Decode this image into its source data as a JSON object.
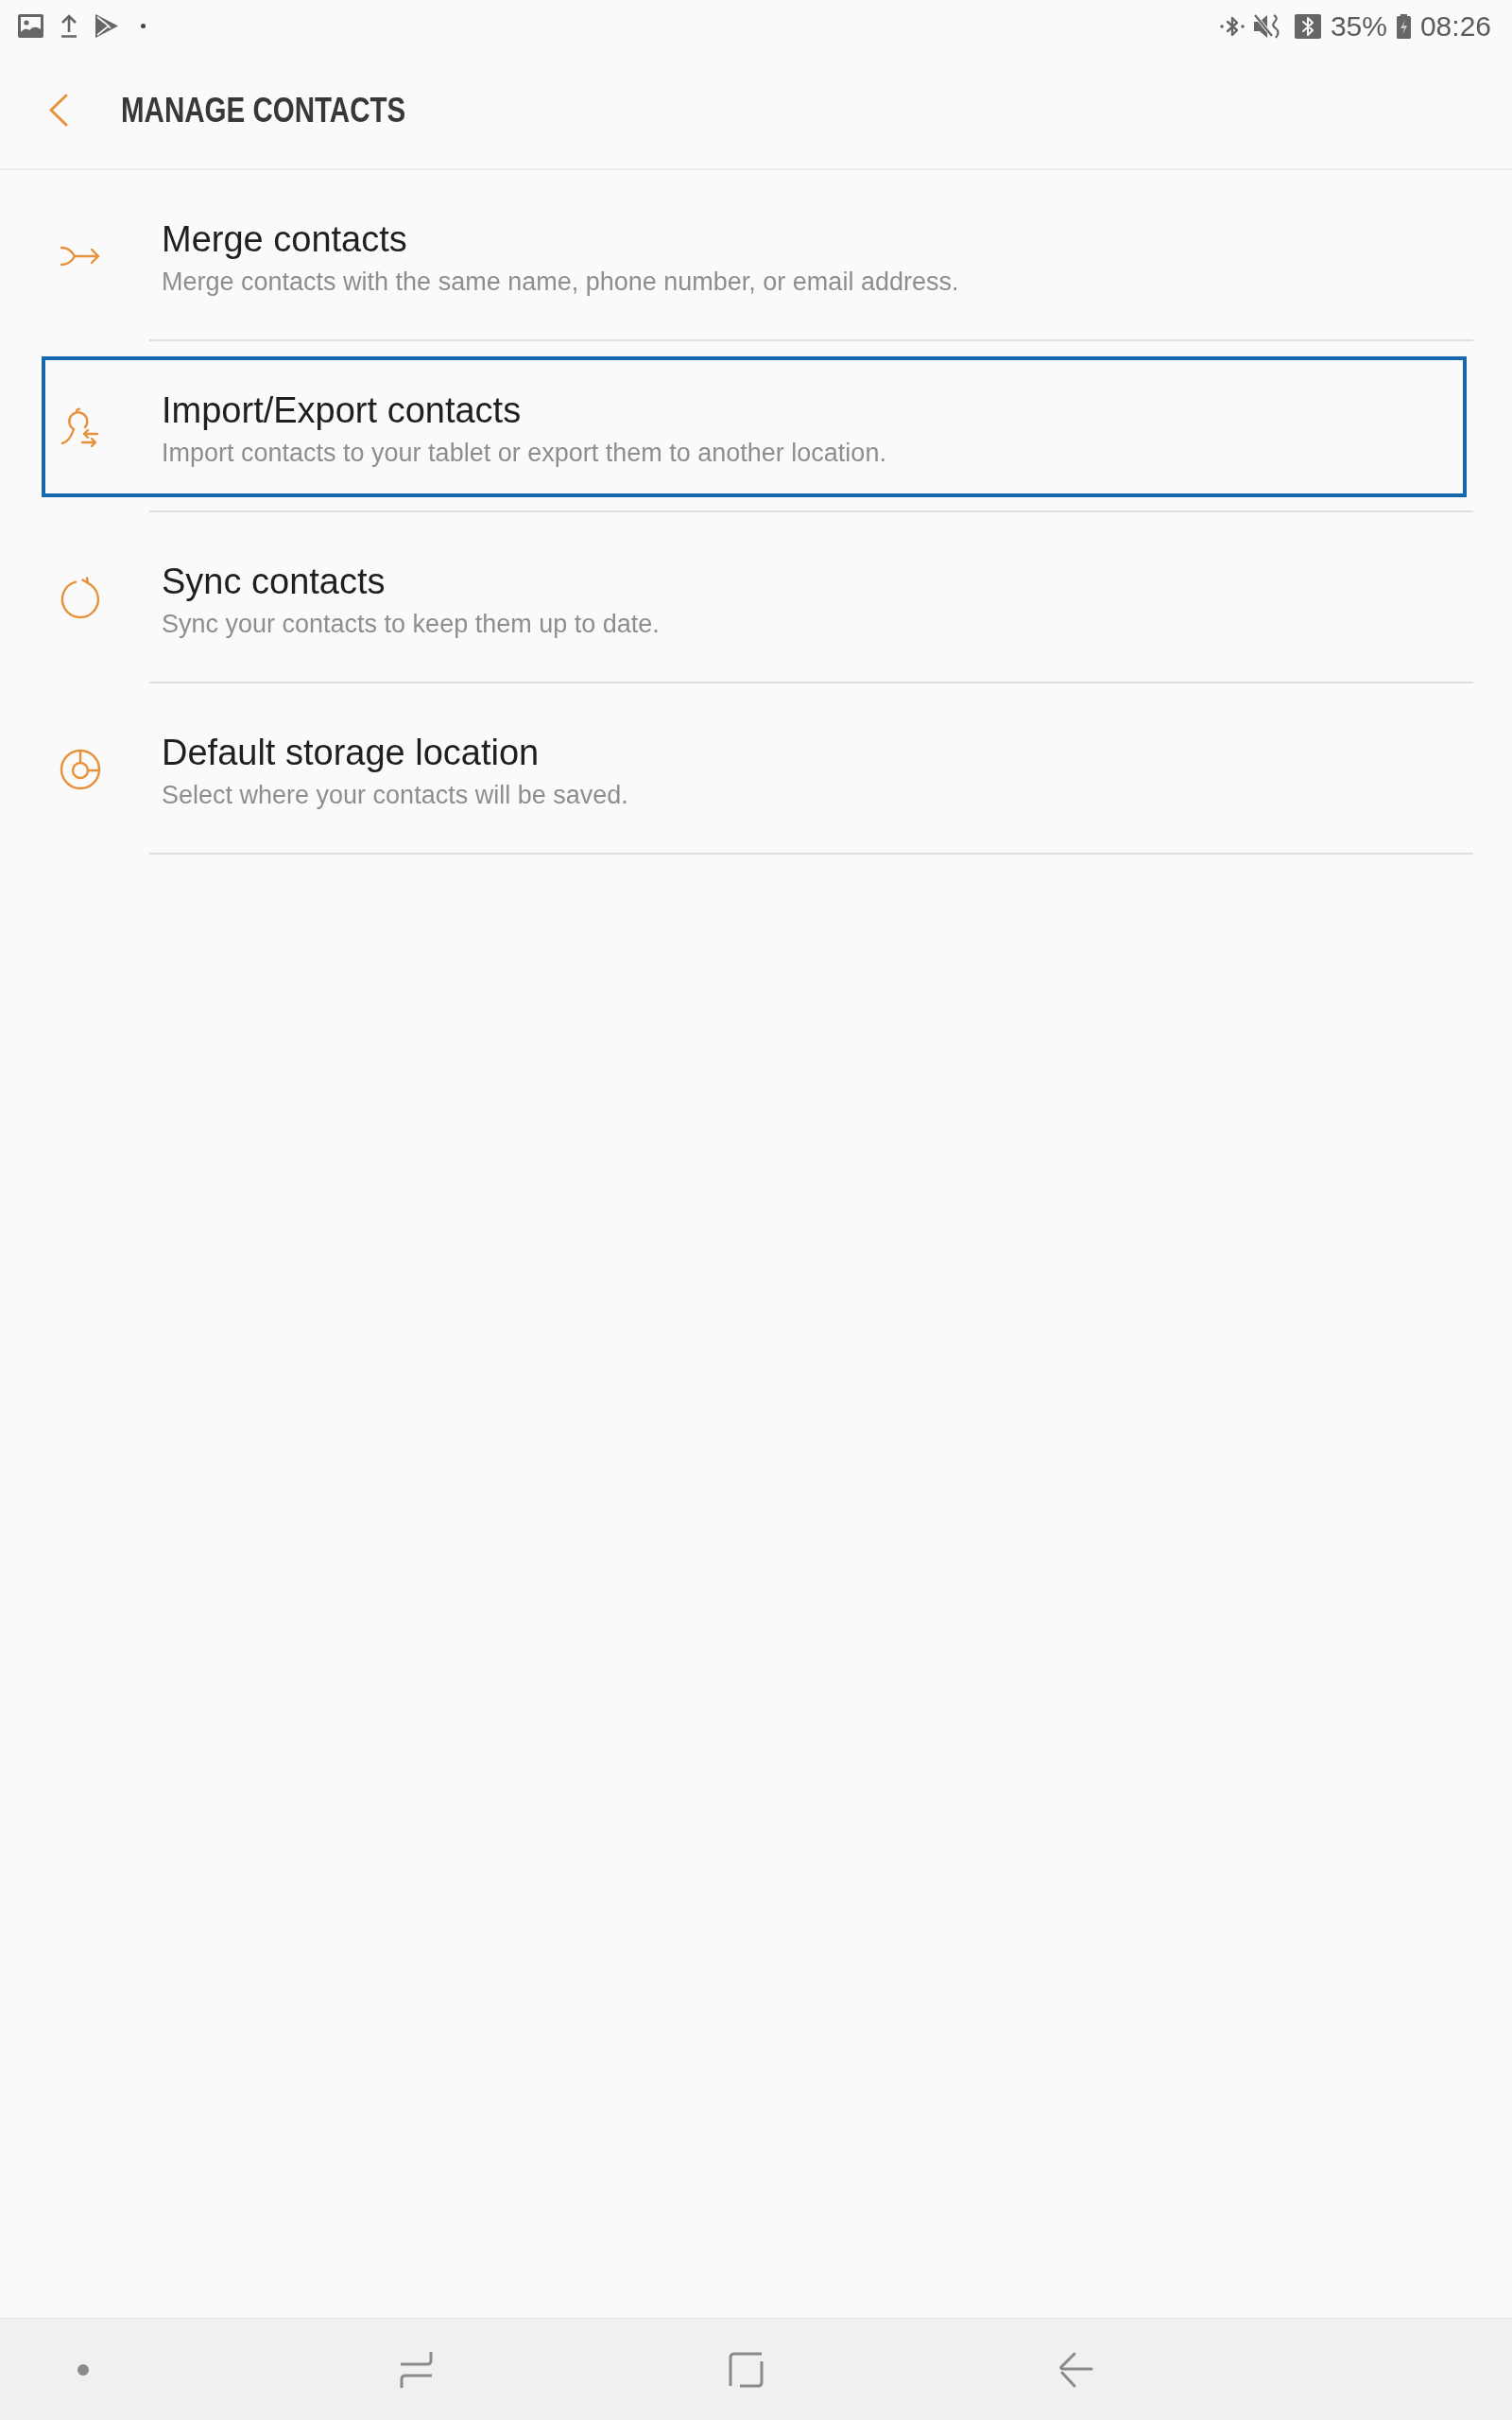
{
  "status_bar": {
    "battery_percent": "35%",
    "time": "08:26"
  },
  "header": {
    "title": "MANAGE CONTACTS"
  },
  "items": [
    {
      "kind": "merge",
      "title": "Merge contacts",
      "subtitle": "Merge contacts with the same name, phone number, or email address.",
      "focused": false
    },
    {
      "kind": "import_export",
      "title": "Import/Export contacts",
      "subtitle": "Import contacts to your tablet or export them to another location.",
      "focused": true
    },
    {
      "kind": "sync",
      "title": "Sync contacts",
      "subtitle": "Sync your contacts to keep them up to date.",
      "focused": false
    },
    {
      "kind": "storage",
      "title": "Default storage location",
      "subtitle": "Select where your contacts will be saved.",
      "focused": false
    }
  ]
}
